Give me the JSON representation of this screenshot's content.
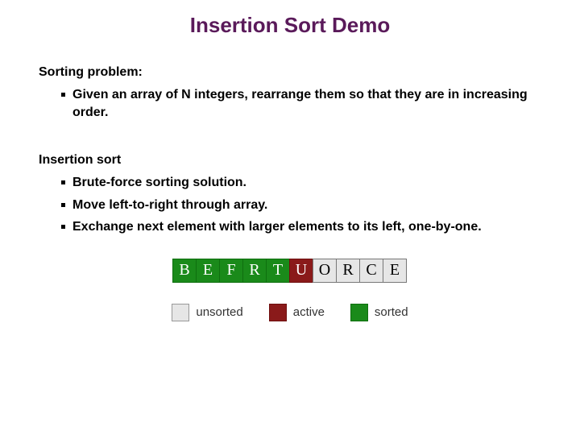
{
  "title": "Insertion Sort Demo",
  "section1": {
    "head": "Sorting problem:",
    "items": [
      "Given an array of N integers, rearrange them so that they are in increasing order."
    ]
  },
  "section2": {
    "head": "Insertion sort",
    "items": [
      "Brute-force sorting solution.",
      "Move left-to-right through array.",
      "Exchange next element with larger elements to its left, one-by-one."
    ]
  },
  "cells": [
    {
      "letter": "B",
      "state": "sorted"
    },
    {
      "letter": "E",
      "state": "sorted"
    },
    {
      "letter": "F",
      "state": "sorted"
    },
    {
      "letter": "R",
      "state": "sorted"
    },
    {
      "letter": "T",
      "state": "sorted"
    },
    {
      "letter": "U",
      "state": "active"
    },
    {
      "letter": "O",
      "state": "unsorted"
    },
    {
      "letter": "R",
      "state": "unsorted"
    },
    {
      "letter": "C",
      "state": "unsorted"
    },
    {
      "letter": "E",
      "state": "unsorted"
    }
  ],
  "legend": {
    "unsorted": "unsorted",
    "active": "active",
    "sorted": "sorted"
  }
}
